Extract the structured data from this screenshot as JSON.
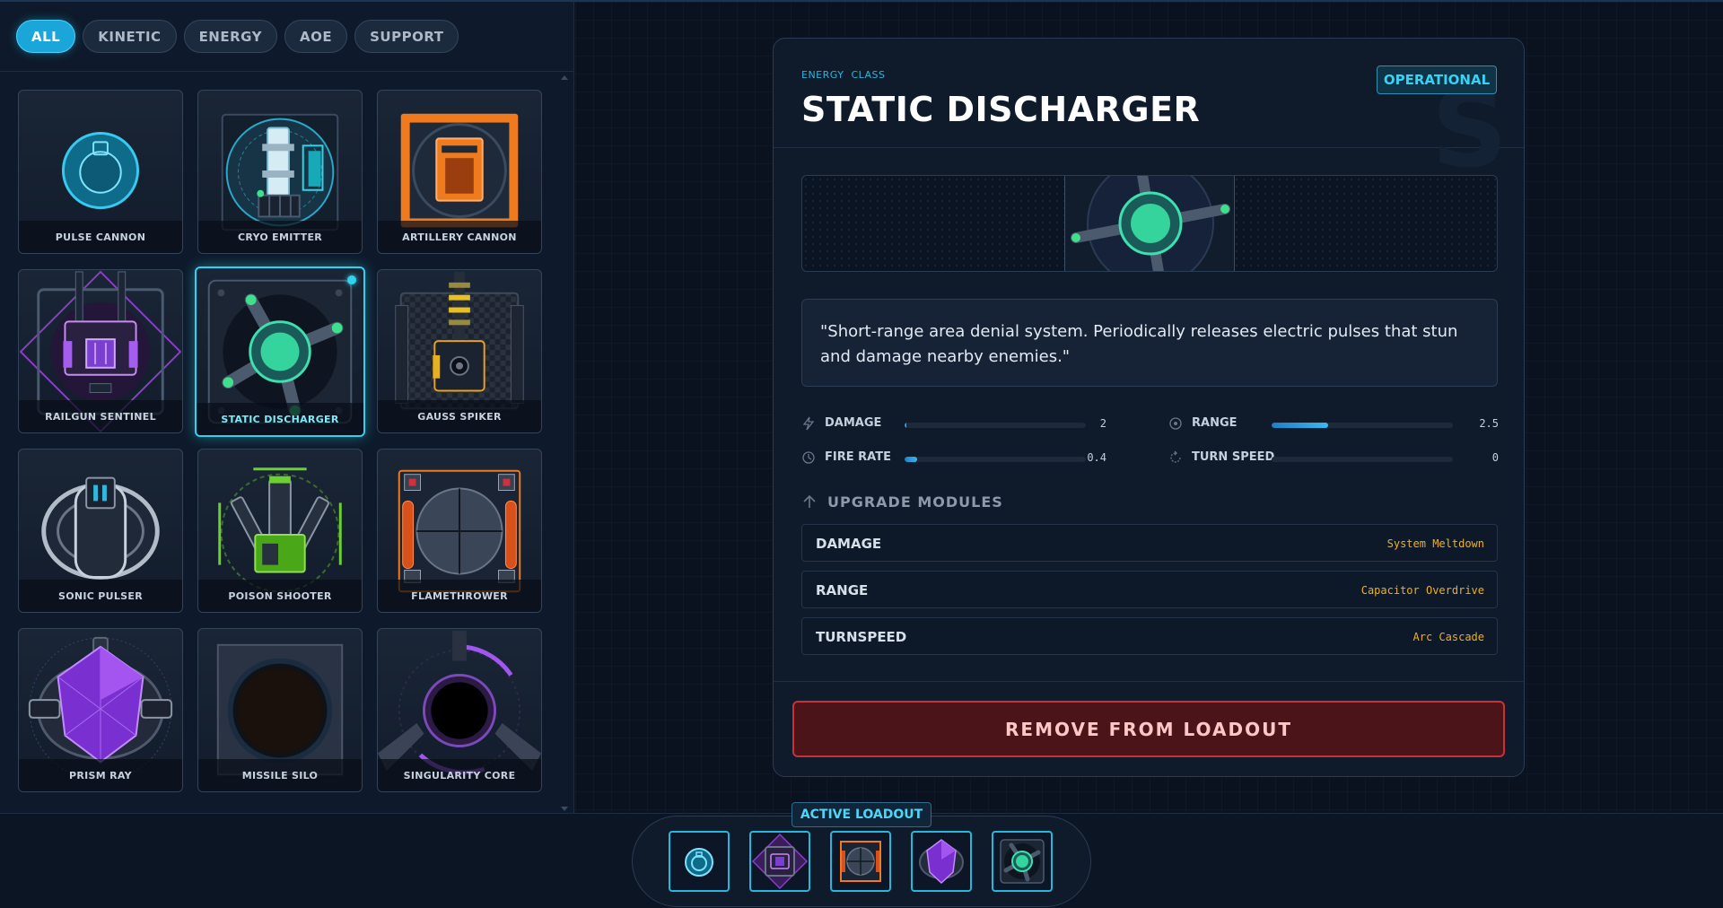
{
  "filters": [
    {
      "label": "ALL",
      "active": true
    },
    {
      "label": "KINETIC",
      "active": false
    },
    {
      "label": "ENERGY",
      "active": false
    },
    {
      "label": "AOE",
      "active": false
    },
    {
      "label": "SUPPORT",
      "active": false
    }
  ],
  "weapons": [
    {
      "name": "PULSE CANNON"
    },
    {
      "name": "CRYO EMITTER"
    },
    {
      "name": "ARTILLERY CANNON"
    },
    {
      "name": "RAILGUN SENTINEL"
    },
    {
      "name": "STATIC DISCHARGER"
    },
    {
      "name": "GAUSS SPIKER"
    },
    {
      "name": "SONIC PULSER"
    },
    {
      "name": "POISON SHOOTER"
    },
    {
      "name": "FLAMETHROWER"
    },
    {
      "name": "PRISM RAY"
    },
    {
      "name": "MISSILE SILO"
    },
    {
      "name": "SINGULARITY CORE"
    }
  ],
  "detail": {
    "class_tag": "ENERGY  CLASS",
    "title": "STATIC DISCHARGER",
    "status": "OPERATIONAL",
    "watermark": "S",
    "description": "\"Short-range area denial system. Periodically releases electric pulses that stun and damage nearby enemies.\"",
    "stats": {
      "damage": {
        "label": "DAMAGE",
        "value": "2",
        "fill": 0.01
      },
      "range": {
        "label": "RANGE",
        "value": "2.5",
        "fill": 0.31
      },
      "fire_rate": {
        "label": "FIRE RATE",
        "value": "0.4",
        "fill": 0.07
      },
      "turn_speed": {
        "label": "TURN SPEED",
        "value": "0",
        "fill": 0
      }
    },
    "upgrades_title": "UPGRADE MODULES",
    "upgrades": [
      {
        "name": "DAMAGE",
        "value": "System Meltdown"
      },
      {
        "name": "RANGE",
        "value": "Capacitor Overdrive"
      },
      {
        "name": "TURNSPEED",
        "value": "Arc Cascade"
      }
    ],
    "remove_label": "REMOVE FROM LOADOUT"
  },
  "loadout": {
    "label": "ACTIVE LOADOUT"
  },
  "colors": {
    "accent": "#2fd3ee",
    "danger": "#c9303a",
    "upgrade_value": "#f0b020"
  }
}
